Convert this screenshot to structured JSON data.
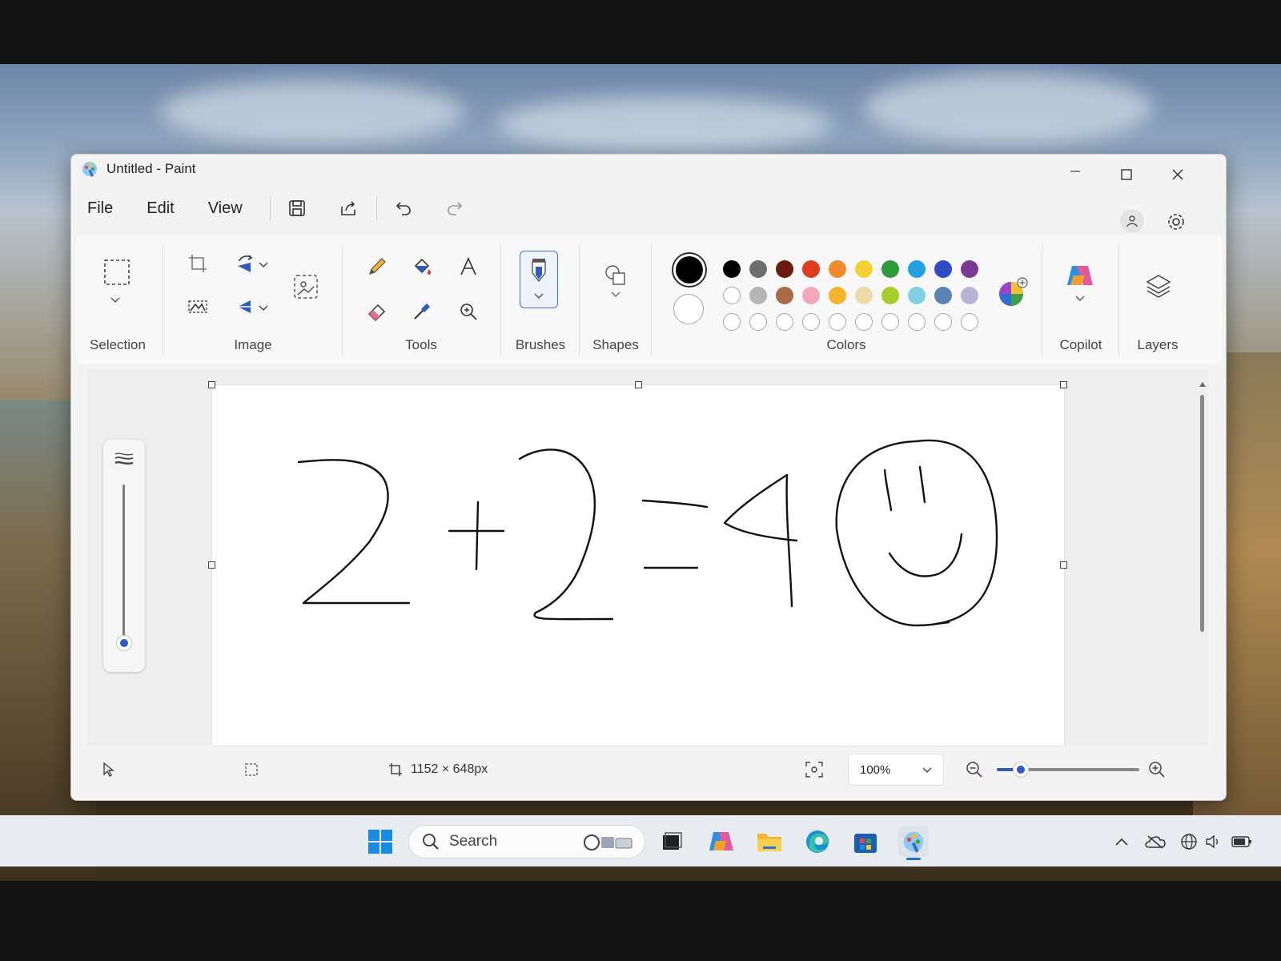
{
  "window": {
    "title": "Untitled - Paint"
  },
  "menu": {
    "file": "File",
    "edit": "Edit",
    "view": "View"
  },
  "ribbon": {
    "selection_label": "Selection",
    "image_label": "Image",
    "tools_label": "Tools",
    "brushes_label": "Brushes",
    "shapes_label": "Shapes",
    "colors_label": "Colors",
    "copilot_label": "Copilot",
    "layers_label": "Layers"
  },
  "colors": {
    "primary": "#000000",
    "secondary": "#ffffff",
    "row1": [
      "#000000",
      "#6e6e6e",
      "#6b1a10",
      "#e03b1c",
      "#f08a2c",
      "#f2d235",
      "#2e9a3a",
      "#1fa0e0",
      "#2f4cc4",
      "#7a3a94"
    ],
    "row2": [
      "#ffffff",
      "#b5b5b5",
      "#a96a48",
      "#f2a8b8",
      "#f4b52c",
      "#eedaa6",
      "#a8cc2a",
      "#82cfe2",
      "#5a84b0",
      "#b9b3d8"
    ],
    "row3_empty": 10
  },
  "canvas": {
    "content": "2+2=4 ☺"
  },
  "status": {
    "canvas_size": "1152 × 648px",
    "zoom": "100%"
  },
  "taskbar": {
    "search_placeholder": "Search"
  },
  "icons": {
    "save": "save-icon",
    "share": "share-icon",
    "undo": "undo-icon",
    "redo": "redo-icon",
    "pencil": "pencil-icon",
    "fill": "fill-icon",
    "text": "text-icon",
    "eraser": "eraser-icon",
    "picker": "color-picker-icon",
    "magnifier": "magnifier-icon"
  }
}
